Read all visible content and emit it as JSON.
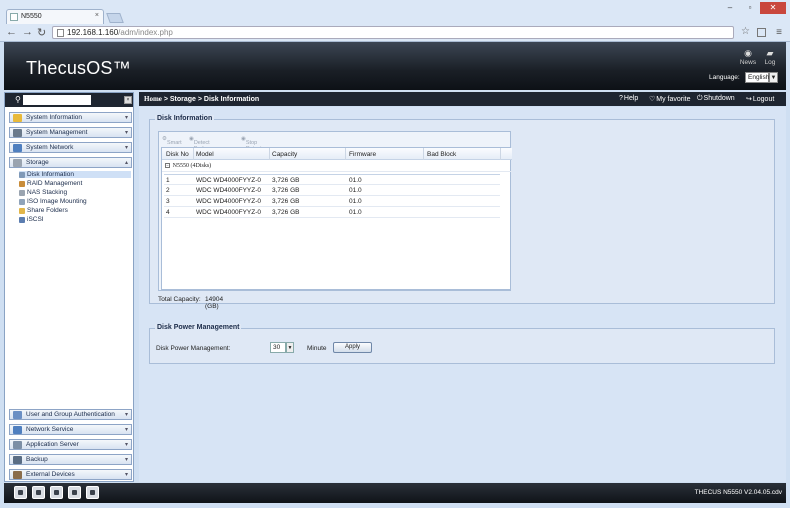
{
  "browser": {
    "tab_title": "N5550",
    "tab_close": "×",
    "url_host": "192.168.1.160",
    "url_path": "/adm/index.php"
  },
  "header": {
    "logo": "ThecusOS™",
    "news": "News",
    "log": "Log",
    "language_label": "Language:",
    "language_value": "English"
  },
  "sidebar": {
    "groups_top": [
      {
        "label": "System Information",
        "color": "#e8b93a"
      },
      {
        "label": "System Management",
        "color": "#6a7a8c"
      },
      {
        "label": "System Network",
        "color": "#4f7fbf"
      },
      {
        "label": "Storage",
        "color": "#9aa4b0"
      }
    ],
    "storage_items": [
      {
        "label": "Disk Information",
        "color": "#7f99b8"
      },
      {
        "label": "RAID Management",
        "color": "#c98d3a"
      },
      {
        "label": "NAS Stacking",
        "color": "#9aa4b0"
      },
      {
        "label": "ISO Image Mounting",
        "color": "#8fa3ba"
      },
      {
        "label": "Share Folders",
        "color": "#e2b649"
      },
      {
        "label": "iSCSI",
        "color": "#5b7db0"
      }
    ],
    "groups_bottom": [
      {
        "label": "User and Group Authentication",
        "color": "#6a8fc4"
      },
      {
        "label": "Network Service",
        "color": "#4f7fbf"
      },
      {
        "label": "Application Server",
        "color": "#7c8fa6"
      },
      {
        "label": "Backup",
        "color": "#5a6d84"
      },
      {
        "label": "External Devices",
        "color": "#8a6d4b"
      }
    ]
  },
  "topbar": {
    "crumb_home": "Home",
    "crumb_rest": " > Storage > Disk Information",
    "help": "Help",
    "favorite": "My favorite",
    "shutdown": "Shutdown",
    "logout": "Logout"
  },
  "disk_info": {
    "legend": "Disk Information",
    "toolbar": {
      "smart": "Smart",
      "detect": "Detect Bad Block",
      "stop": "Stop Detect Bad Block"
    },
    "columns": [
      "Disk No",
      "Model",
      "Capacity",
      "Firmware",
      "Bad Block"
    ],
    "group": "N5550 (4Disks)",
    "rows": [
      {
        "no": "1",
        "model": "WDC WD4000FYYZ-0",
        "capacity": "3,726 GB",
        "firmware": "01.0"
      },
      {
        "no": "2",
        "model": "WDC WD4000FYYZ-0",
        "capacity": "3,726 GB",
        "firmware": "01.0"
      },
      {
        "no": "3",
        "model": "WDC WD4000FYYZ-0",
        "capacity": "3,726 GB",
        "firmware": "01.0"
      },
      {
        "no": "4",
        "model": "WDC WD4000FYYZ-0",
        "capacity": "3,726 GB",
        "firmware": "01.0"
      }
    ],
    "total_label": "Total Capacity:",
    "total_value": "14904 (GB)"
  },
  "power": {
    "legend": "Disk Power Management",
    "label": "Disk Power Management:",
    "value": "30",
    "unit": "Minute",
    "apply": "Apply"
  },
  "footer": {
    "version": "THECUS N5550 V2.04.05.cdv"
  }
}
